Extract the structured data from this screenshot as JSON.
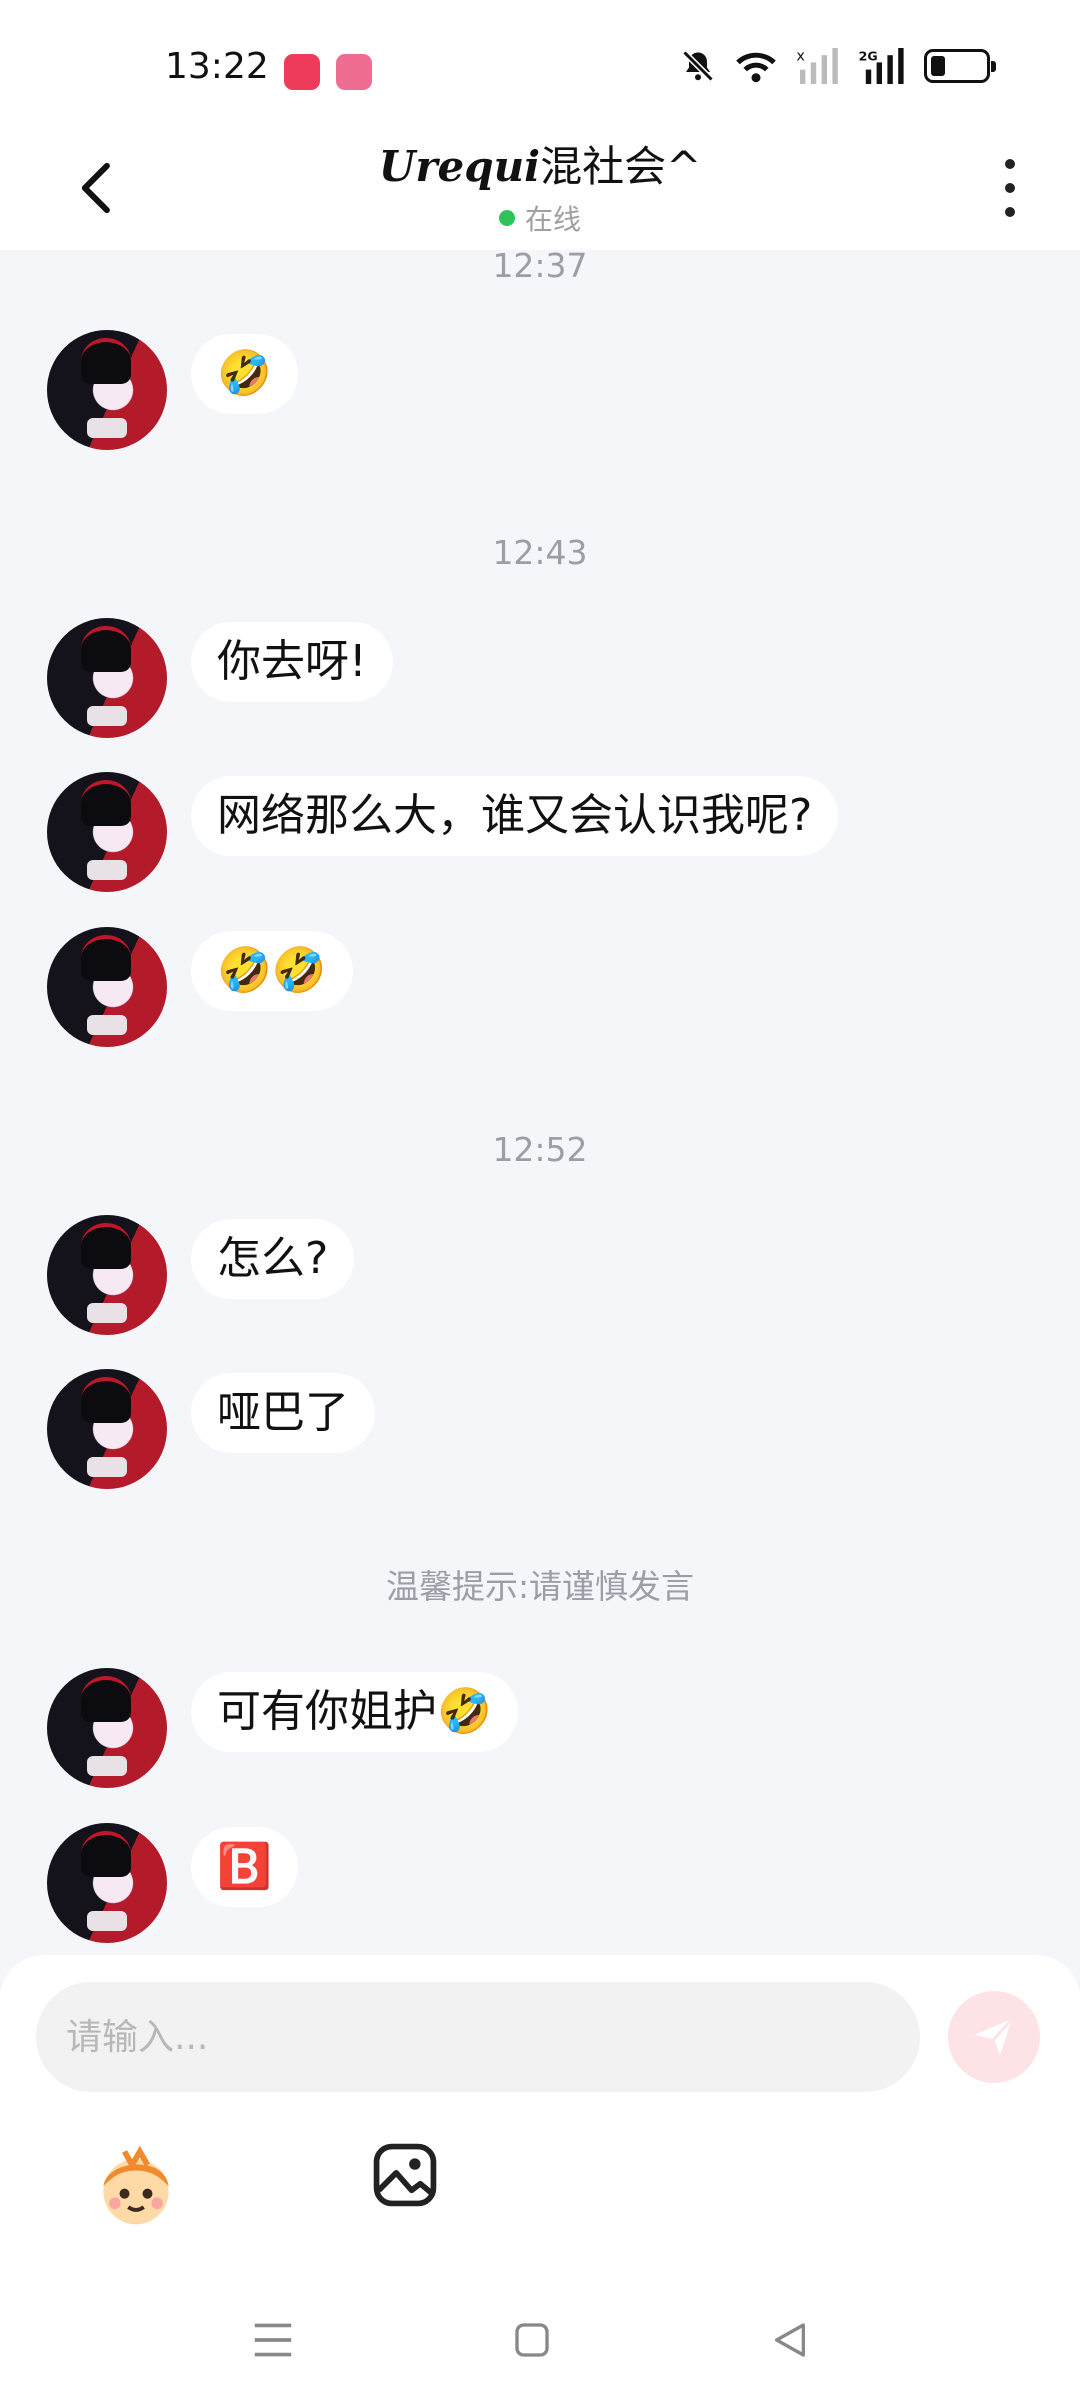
{
  "status_bar": {
    "time": "13:22",
    "icons": [
      "mute-bell-icon",
      "wifi-icon",
      "signal-icon",
      "signal-2g-icon",
      "battery-icon"
    ],
    "battery_level": 0.25,
    "network_label": "2G"
  },
  "header": {
    "title_stylized": "Urequi",
    "title_rest": "混社会^",
    "status": "在线",
    "status_color": "#2fc45a"
  },
  "messages": [
    {
      "time": "12:37"
    },
    {
      "text": "🤣"
    },
    {
      "time": "12:43"
    },
    {
      "text": "你去呀!"
    },
    {
      "text": "网络那么大，谁又会认识我呢?"
    },
    {
      "text": "🤣🤣"
    },
    {
      "time": "12:52"
    },
    {
      "text": "怎么?"
    },
    {
      "text": "哑巴了"
    },
    {
      "tip": "温馨提示:请谨慎发言"
    },
    {
      "text": "可有你姐护🤣"
    },
    {
      "text": "🅱️"
    }
  ],
  "input": {
    "placeholder": "请输入...",
    "value": ""
  },
  "colors": {
    "background": "#f4f6f9",
    "bubble": "#ffffff",
    "send_button_disabled": "#fde3e5",
    "accent": "#f2606f"
  }
}
